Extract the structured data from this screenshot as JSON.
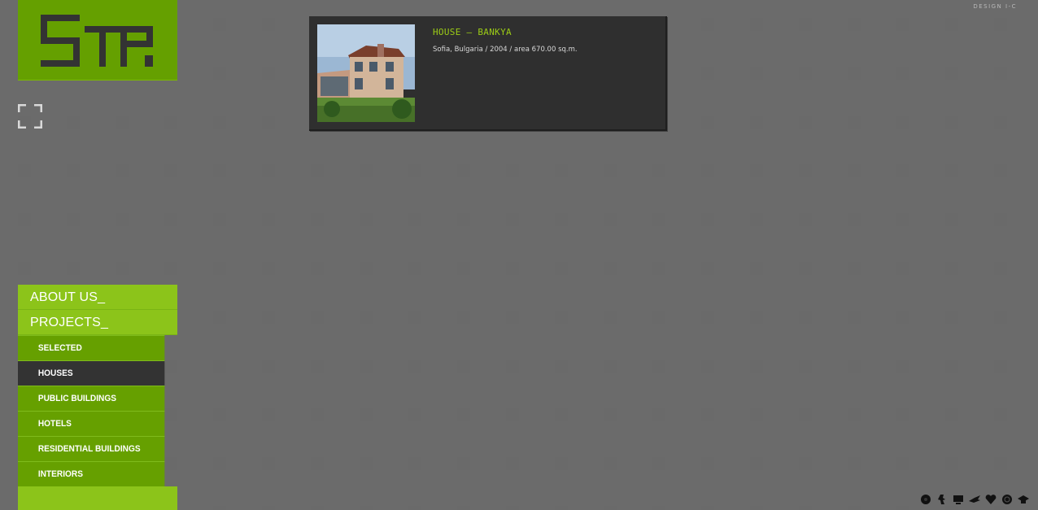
{
  "header": {
    "design_credit": "DESIGN I-C"
  },
  "logo": {
    "alt": "SP logo",
    "color": "#65a000"
  },
  "project": {
    "title": "HOUSE – BANKYA",
    "description": "Sofia, Bulgaria / 2004 / area 670.00 sq.m."
  },
  "menu": {
    "main": [
      {
        "label": "ABOUT US_"
      },
      {
        "label": "PROJECTS_"
      }
    ],
    "sub": [
      {
        "label": "SELECTED"
      },
      {
        "label": "HOUSES",
        "active": true
      },
      {
        "label": "PUBLIC BUILDINGS"
      },
      {
        "label": "HOTELS"
      },
      {
        "label": "RESIDENTIAL BUILDINGS"
      },
      {
        "label": "INTERIORS"
      }
    ]
  },
  "tray_icons": [
    "spinner-icon",
    "figure-icon",
    "monitor-icon",
    "bird-icon",
    "heart-icon",
    "globe-icon",
    "cap-icon"
  ],
  "colors": {
    "background": "#333333",
    "dot": "#6a6a6a",
    "accent_green": "#8cc41a",
    "dark_green": "#66a000",
    "title_green": "#9ccc16"
  }
}
